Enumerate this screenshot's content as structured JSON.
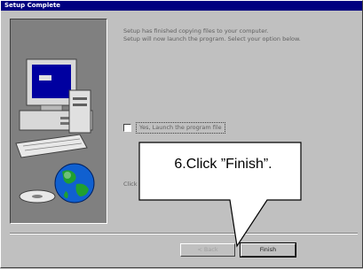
{
  "window": {
    "title": "Setup Complete"
  },
  "message": {
    "line1": "Setup has finished copying files to your computer.",
    "line2": "Setup will now launch the program. Select your option below."
  },
  "launch_option": {
    "label": "Yes, Launch the program file",
    "checked": false
  },
  "click_hint": "Click",
  "buttons": {
    "back_label": "< Back",
    "finish_label": "Finish"
  },
  "callout": {
    "text": "6.Click ”Finish”."
  },
  "icons": {
    "illustration": "computer-with-globe-icon"
  },
  "colors": {
    "titlebar": "#000080",
    "face": "#c0c0c0",
    "panel": "#808080"
  }
}
